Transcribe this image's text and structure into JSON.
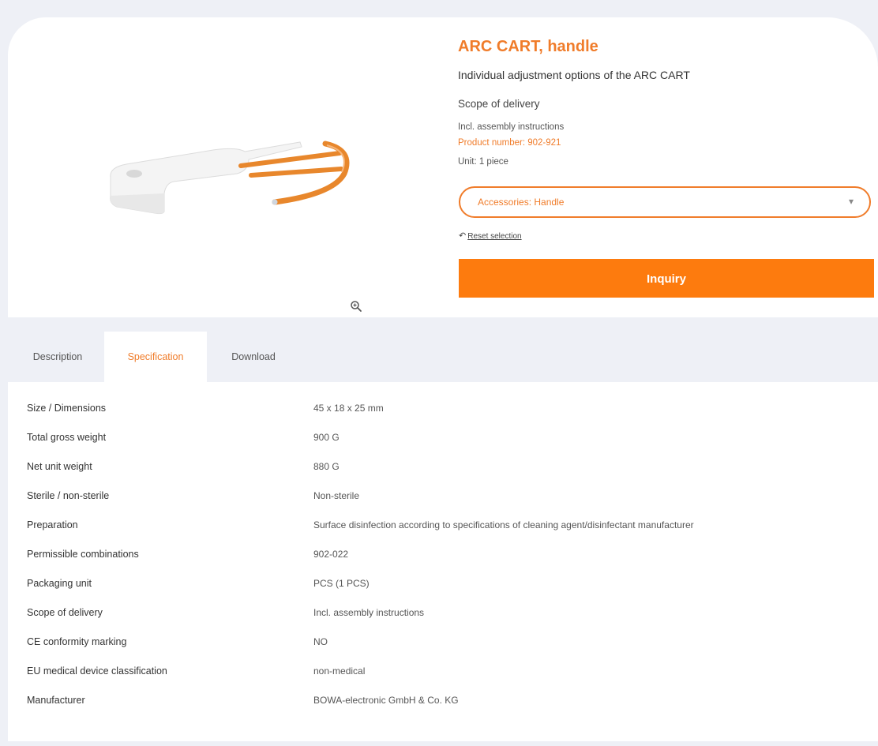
{
  "product": {
    "title": "ARC CART, handle",
    "subtitle": "Individual adjustment options of the ARC CART",
    "scope_heading": "Scope of delivery",
    "scope_line": "Incl. assembly instructions",
    "product_number": "Product number: 902-921",
    "unit": "Unit: 1 piece",
    "image_icon": "product-image",
    "zoom_icon": "zoom-in-icon"
  },
  "selector": {
    "value": "Accessories: Handle",
    "chevron_icon": "chevron-down-icon"
  },
  "reset": {
    "icon": "undo-icon",
    "label": "Reset selection"
  },
  "inquiry_label": "Inquiry",
  "colors": {
    "accent": "#f07c2a",
    "button": "#fd7b0e",
    "background": "#eef0f6"
  },
  "tabs": [
    {
      "label": "Description",
      "active": false
    },
    {
      "label": "Specification",
      "active": true
    },
    {
      "label": "Download",
      "active": false
    }
  ],
  "specs": [
    {
      "label": "Size / Dimensions",
      "value": "45 x 18 x 25 mm"
    },
    {
      "label": "Total gross weight",
      "value": "900 G"
    },
    {
      "label": "Net unit weight",
      "value": "880 G"
    },
    {
      "label": "Sterile / non-sterile",
      "value": "Non-sterile"
    },
    {
      "label": "Preparation",
      "value": "Surface disinfection according to specifications of cleaning agent/disinfectant manufacturer"
    },
    {
      "label": "Permissible combinations",
      "value": "902-022"
    },
    {
      "label": "Packaging unit",
      "value": "PCS (1 PCS)"
    },
    {
      "label": "Scope of delivery",
      "value": "Incl. assembly instructions"
    },
    {
      "label": "CE conformity marking",
      "value": "NO"
    },
    {
      "label": "EU medical device classification",
      "value": "non-medical"
    },
    {
      "label": "Manufacturer",
      "value": "BOWA-electronic GmbH & Co. KG"
    }
  ]
}
